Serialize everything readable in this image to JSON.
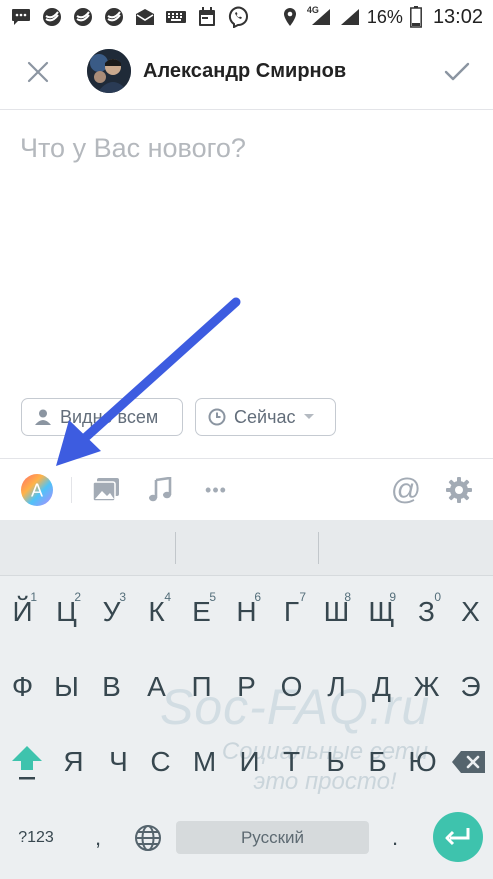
{
  "status_bar": {
    "battery_percent": "16%",
    "network_label": "4G",
    "time": "13:02",
    "icons_left": [
      "chat-icon",
      "sberbank-icon",
      "sberbank-icon",
      "sberbank-icon",
      "mail-icon",
      "keyboard-icon",
      "calendar-icon",
      "viber-icon"
    ],
    "icons_right": [
      "location-icon",
      "signal-icon",
      "signal-icon",
      "battery-icon"
    ]
  },
  "header": {
    "author_name": "Александр Смирнов",
    "close_icon": "close-icon",
    "done_icon": "check-icon"
  },
  "compose": {
    "placeholder": "Что у Вас нового?",
    "value": ""
  },
  "chips": {
    "visibility_label": "Видно всем",
    "time_label": "Сейчас"
  },
  "toolbar": {
    "items": [
      "text-style-icon",
      "photo-icon",
      "music-icon",
      "more-icon",
      "mention-icon",
      "settings-icon"
    ],
    "text_style_letter": "A",
    "more_glyph": "•••",
    "mention_glyph": "@"
  },
  "keyboard": {
    "row1": [
      {
        "label": "Й",
        "hint": "1"
      },
      {
        "label": "Ц",
        "hint": "2"
      },
      {
        "label": "У",
        "hint": "3"
      },
      {
        "label": "К",
        "hint": "4"
      },
      {
        "label": "Е",
        "hint": "5"
      },
      {
        "label": "Н",
        "hint": "6"
      },
      {
        "label": "Г",
        "hint": "7"
      },
      {
        "label": "Ш",
        "hint": "8"
      },
      {
        "label": "Щ",
        "hint": "9"
      },
      {
        "label": "З",
        "hint": "0"
      },
      {
        "label": "Х",
        "hint": ""
      }
    ],
    "row2": [
      "Ф",
      "Ы",
      "В",
      "А",
      "П",
      "Р",
      "О",
      "Л",
      "Д",
      "Ж",
      "Э"
    ],
    "row3": [
      "Я",
      "Ч",
      "С",
      "М",
      "И",
      "Т",
      "Ь",
      "Б",
      "Ю"
    ],
    "row4": {
      "symbols": "?123",
      "comma": ",",
      "space": "Русский",
      "period": "."
    }
  },
  "watermark": {
    "title": "Soc-FAQ.ru",
    "line1": "Социальные сети",
    "line2": "это просто!"
  },
  "colors": {
    "annotation_arrow": "#3d5ce0",
    "enter_key": "#3ec3ad",
    "shift_key": "#3ec3ad"
  }
}
